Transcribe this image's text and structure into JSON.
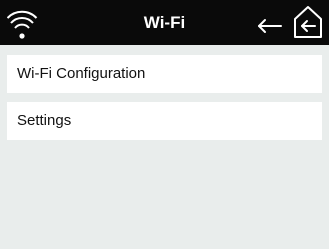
{
  "header": {
    "title": "Wi-Fi",
    "icons": {
      "status": "wifi-icon",
      "back": "back-arrow-icon",
      "home": "home-icon"
    }
  },
  "menu": {
    "items": [
      {
        "label": "Wi-Fi Configuration"
      },
      {
        "label": "Settings"
      }
    ]
  },
  "colors": {
    "topbar": "#0a0a0a",
    "background": "#e9edec",
    "item_background": "#ffffff",
    "text": "#111111"
  }
}
